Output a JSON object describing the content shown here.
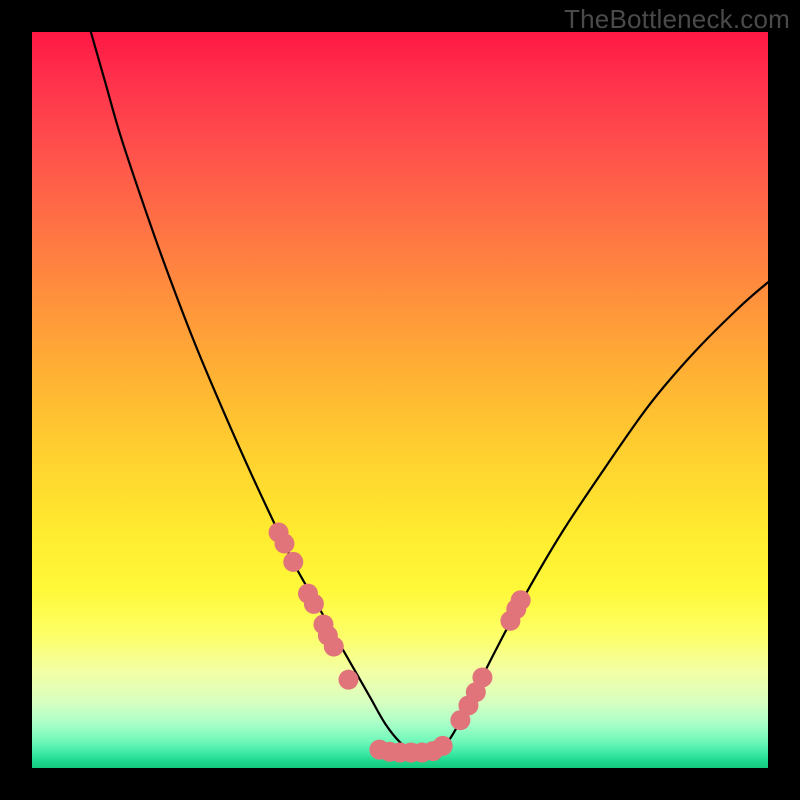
{
  "watermark": "TheBottleneck.com",
  "chart_data": {
    "type": "line",
    "title": "",
    "xlabel": "",
    "ylabel": "",
    "xlim": [
      0,
      100
    ],
    "ylim": [
      0,
      100
    ],
    "grid": false,
    "legend": false,
    "background_gradient": {
      "top": "#ff1744",
      "mid": "#ffd22f",
      "bottom": "#14c97d"
    },
    "series": [
      {
        "name": "curve",
        "stroke": "#000000",
        "x": [
          8,
          10,
          12,
          15,
          18,
          22,
          26,
          30,
          34,
          36,
          38,
          40,
          42,
          44,
          46,
          48,
          50,
          52,
          54,
          56,
          58,
          60,
          63,
          67,
          72,
          78,
          84,
          90,
          96,
          100
        ],
        "y": [
          100,
          93,
          86,
          77,
          68.5,
          58,
          48.5,
          39.5,
          31,
          27,
          23.5,
          20,
          16.5,
          13,
          9.5,
          6,
          3.5,
          2,
          2,
          3,
          6,
          10,
          16,
          23.5,
          32,
          41,
          49.5,
          56.5,
          62.5,
          66
        ]
      }
    ],
    "points": [
      {
        "name": "dots-left",
        "color": "#e1747b",
        "r": 10,
        "x": [
          33.5,
          34.3,
          35.5,
          37.5,
          38.3,
          39.6,
          40.2,
          41.0,
          43.0
        ],
        "y": [
          32.0,
          30.5,
          28.0,
          23.7,
          22.3,
          19.5,
          18.0,
          16.5,
          12.0
        ]
      },
      {
        "name": "dots-right",
        "color": "#e1747b",
        "r": 10,
        "x": [
          58.2,
          59.3,
          60.3,
          61.2,
          65.0,
          65.8,
          66.4
        ],
        "y": [
          6.5,
          8.5,
          10.3,
          12.3,
          20.0,
          21.6,
          22.8
        ]
      },
      {
        "name": "dots-bottom",
        "color": "#e1747b",
        "r": 10,
        "x": [
          47.2,
          48.6,
          50.0,
          51.5,
          53.0,
          54.5,
          55.8
        ],
        "y": [
          2.5,
          2.2,
          2.1,
          2.1,
          2.1,
          2.3,
          3.0
        ]
      }
    ]
  }
}
